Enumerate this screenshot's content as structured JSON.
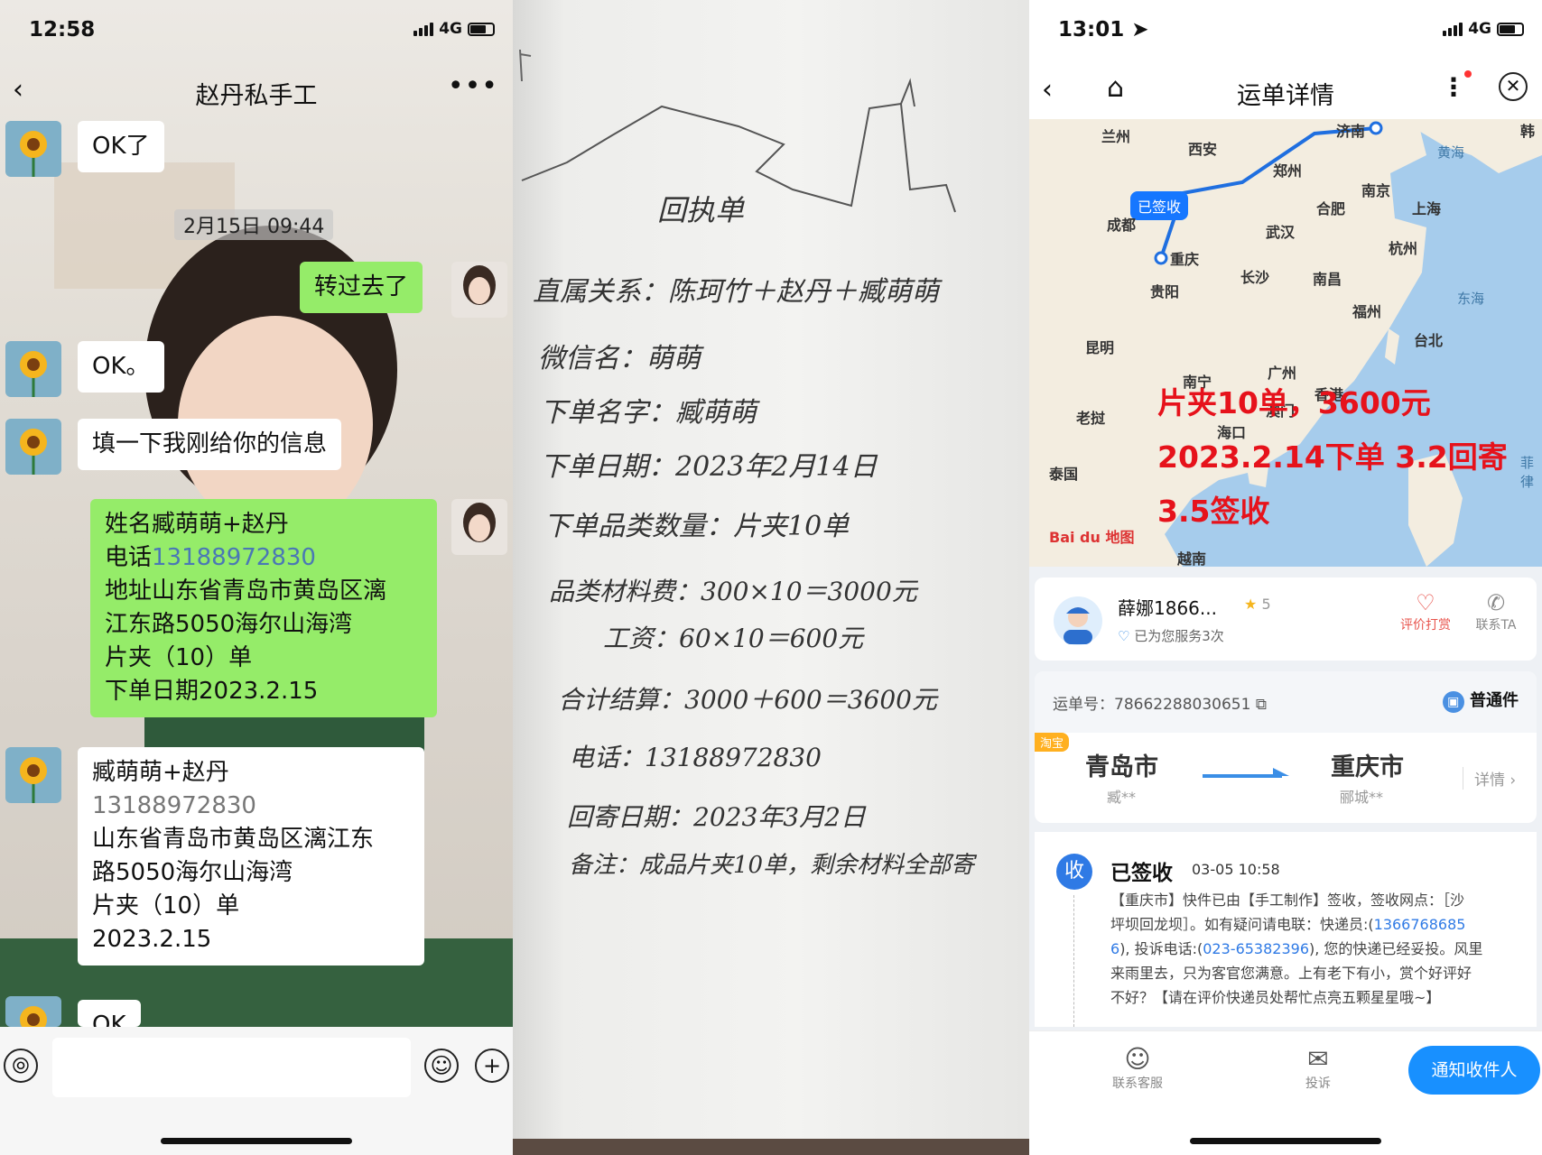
{
  "chat": {
    "status_time": "12:58",
    "network": "4G",
    "title": "赵丹私手工",
    "timestamp": "2月15日 09:44",
    "msg1": "OK了",
    "msg2": "转过去了",
    "msg3": "OK。",
    "msg4": "填一下我刚给你的信息",
    "form": {
      "l1": "姓名臧萌萌+赵丹",
      "l2_label": "电话",
      "l2_phone": "13188972830",
      "l3": "地址山东省青岛市黄岛区漓",
      "l4": "江东路5050海尔山海湾",
      "l5": "片夹（10）单",
      "l6": "下单日期2023.2.15"
    },
    "reply": {
      "l1": "臧萌萌+赵丹",
      "l2": "13188972830",
      "l3": "山东省青岛市黄岛区漓江东",
      "l4": "路5050海尔山海湾",
      "l5": "片夹（10）单",
      "l6": "2023.2.15"
    },
    "msg_partial": "OK"
  },
  "paper": {
    "title": "回执单",
    "lines": [
      "直属关系：陈珂竹＋赵丹＋臧萌萌",
      "微信名：萌萌",
      "下单名字：臧萌萌",
      "下单日期：2023年2月14日",
      "下单品类数量：片夹10单",
      "品类材料费：300×10＝3000元",
      "工资：60×10＝600元",
      "合计结算：3000＋600＝3600元",
      "电话：13188972830",
      "回寄日期：2023年3月2日",
      "备注：成品片夹10单，剩余材料全部寄"
    ]
  },
  "waybill": {
    "status_time": "13:01",
    "network": "4G",
    "title": "运单详情",
    "map": {
      "bubble": "已签收",
      "cities": [
        "兰州",
        "西安",
        "郑州",
        "济南",
        "成都",
        "重庆",
        "武汉",
        "合肥",
        "南京",
        "上海",
        "杭州",
        "长沙",
        "南昌",
        "贵阳",
        "福州",
        "台北",
        "昆明",
        "南宁",
        "广州",
        "香港",
        "澳门",
        "海口",
        "老挝",
        "泰国",
        "越南",
        "韩"
      ],
      "seas": [
        "黄海",
        "东海",
        "菲律"
      ],
      "logo": "Bai du 地图",
      "overlay": [
        "片夹10单，3600元",
        "2023.2.14下单 3.2回寄",
        "3.5签收"
      ]
    },
    "courier": {
      "name": "薛娜1866...",
      "rating": "5",
      "served": "已为您服务3次",
      "tip_label": "评价打赏",
      "contact_label": "联系TA"
    },
    "order": {
      "label": "运单号：78662288030651",
      "type": "普通件",
      "tag": "淘宝",
      "from_city": "青岛市",
      "from_name": "臧**",
      "to_city": "重庆市",
      "to_name": "郦城**",
      "detail": "详情"
    },
    "track": {
      "icon_char": "收",
      "status": "已签收",
      "time": "03-05 10:58",
      "t1": "【重庆市】快件已由【手工制作】签收，签收网点：［沙",
      "t2a": "坪坝回龙坝］。如有疑问请电联：快递员:(",
      "t2b": "1366768685",
      "t3a": "6",
      "t3b": "),  投诉电话:(",
      "t3c": "023-65382396",
      "t3d": "), 您的快递已经妥投。风里",
      "t4": "来雨里去，只为客官您满意。上有老下有小，赏个好评好",
      "t5": "不好？【请在评价快递员处帮忙点亮五颗星星哦~】"
    },
    "bottom": {
      "service": "联系客服",
      "complaint": "投诉",
      "notify": "通知收件人"
    },
    "colors": {
      "route": "#1f6fe0",
      "bubble": "#1677ff",
      "overlay": "#e6121b",
      "notify": "#1890ff"
    }
  }
}
